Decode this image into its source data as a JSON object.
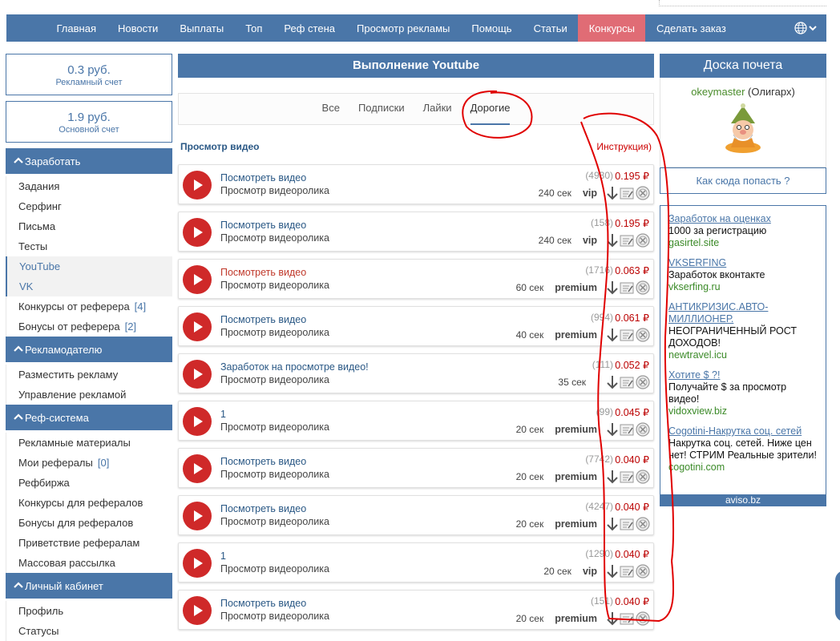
{
  "topnav": [
    "Главная",
    "Новости",
    "Выплаты",
    "Топ",
    "Реф стена",
    "Просмотр рекламы",
    "Помощь",
    "Статьи",
    "Конкурсы",
    "Сделать заказ"
  ],
  "balances": [
    {
      "amount": "0.3 руб.",
      "label": "Рекламный счет"
    },
    {
      "amount": "1.9 руб.",
      "label": "Основной счет"
    }
  ],
  "sidebar": [
    {
      "heading": "Заработать",
      "items": [
        {
          "label": "Задания"
        },
        {
          "label": "Серфинг"
        },
        {
          "label": "Письма"
        },
        {
          "label": "Тесты"
        },
        {
          "label": "YouTube"
        },
        {
          "label": "VK"
        },
        {
          "label": "Конкурсы от реферера",
          "count": "[4]"
        },
        {
          "label": "Бонусы от реферера",
          "count": "[2]"
        }
      ]
    },
    {
      "heading": "Рекламодателю",
      "items": [
        {
          "label": "Разместить рекламу"
        },
        {
          "label": "Управление рекламой"
        }
      ]
    },
    {
      "heading": "Реф-система",
      "items": [
        {
          "label": "Рекламные материалы"
        },
        {
          "label": "Мои рефералы",
          "count": "[0]"
        },
        {
          "label": "Рефбиржа"
        },
        {
          "label": "Конкурсы для рефералов"
        },
        {
          "label": "Бонусы для рефералов"
        },
        {
          "label": "Приветствие рефералам"
        },
        {
          "label": "Массовая рассылка"
        }
      ]
    },
    {
      "heading": "Личный кабинет",
      "items": [
        {
          "label": "Профиль"
        },
        {
          "label": "Статусы"
        }
      ]
    }
  ],
  "center": {
    "title": "Выполнение Youtube",
    "tabs": [
      "Все",
      "Подписки",
      "Лайки",
      "Дорогие"
    ],
    "section_label": "Просмотр видео",
    "section_link": "Инструкция)"
  },
  "tasks": [
    {
      "title": "Посмотреть видео",
      "sub": "Просмотр видеоролика",
      "count": "(4930)",
      "price": "0.195 ₽",
      "duration": "240 сек",
      "tier": "vip"
    },
    {
      "title": "Посмотреть видео",
      "sub": "Просмотр видеоролика",
      "count": "(158)",
      "price": "0.195 ₽",
      "duration": "240 сек",
      "tier": "vip"
    },
    {
      "title": "Посмотреть видео",
      "sub": "Просмотр видеоролика",
      "count": "(1716)",
      "price": "0.063 ₽",
      "duration": "60 сек",
      "tier": "premium",
      "red": true
    },
    {
      "title": "Посмотреть видео",
      "sub": "Просмотр видеоролика",
      "count": "(994)",
      "price": "0.061 ₽",
      "duration": "40 сек",
      "tier": "premium"
    },
    {
      "title": "Заработок на просмотре видео!",
      "sub": "Просмотр видеоролика",
      "count": "(111)",
      "price": "0.052 ₽",
      "duration": "35 сек",
      "tier": ""
    },
    {
      "title": "1",
      "sub": "Просмотр видеоролика",
      "count": "(99)",
      "price": "0.045 ₽",
      "duration": "20 сек",
      "tier": "premium"
    },
    {
      "title": "Посмотреть видео",
      "sub": "Просмотр видеоролика",
      "count": "(7742)",
      "price": "0.040 ₽",
      "duration": "20 сек",
      "tier": "premium"
    },
    {
      "title": "Посмотреть видео",
      "sub": "Просмотр видеоролика",
      "count": "(4247)",
      "price": "0.040 ₽",
      "duration": "20 сек",
      "tier": "premium"
    },
    {
      "title": "1",
      "sub": "Просмотр видеоролика",
      "count": "(1290)",
      "price": "0.040 ₽",
      "duration": "20 сек",
      "tier": "vip"
    },
    {
      "title": "Посмотреть видео",
      "sub": "Просмотр видеоролика",
      "count": "(151)",
      "price": "0.040 ₽",
      "duration": "20 сек",
      "tier": "premium"
    }
  ],
  "right": {
    "title": "Доска почета",
    "user_name": "okeymaster",
    "user_rank": "(Олигарх)",
    "howto": "Как сюда попасть ?",
    "ads": [
      {
        "title": "Заработок на оценках",
        "body": "1000 за регистрацию",
        "url": "gasirtel.site"
      },
      {
        "title": "VKSERFING",
        "body": "Заработок вконтакте",
        "url": "vkserfing.ru"
      },
      {
        "title": "АНТИКРИЗИС.АВТО-МИЛЛИОНЕР.",
        "body": "НЕОГРАНИЧЕННЫЙ РОСТ ДОХОДОВ!",
        "url": "newtravel.icu"
      },
      {
        "title": "Хотите $ ?!",
        "body": "Получайте $ за просмотр видео!",
        "url": "vidoxview.biz"
      },
      {
        "title": "Cogotini-Накрутка соц. сетей",
        "body": "Накрутка соц. сетей. Ниже цен нет! СТРИМ Реальные зрители!",
        "url": "cogotini.com"
      }
    ],
    "ads_footer": "aviso.bz"
  },
  "colors": {
    "brand": "#4a76a8",
    "active_nav": "#e06c75",
    "price": "#b00000",
    "annotation": "#e00000"
  }
}
